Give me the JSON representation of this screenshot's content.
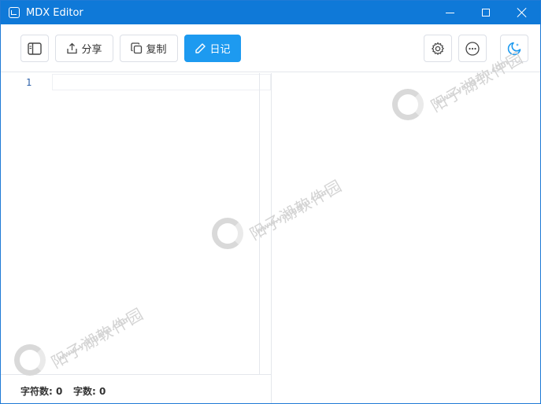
{
  "window": {
    "title": "MDX Editor",
    "controls": {
      "minimize": "minimize",
      "maximize": "maximize",
      "close": "close"
    }
  },
  "toolbar": {
    "sidebar_toggle_icon": "sidebar-icon",
    "share_label": "分享",
    "copy_label": "复制",
    "diary_label": "日记",
    "settings_icon": "gear-icon",
    "more_icon": "more-icon",
    "theme_icon": "moon-icon"
  },
  "editor": {
    "line_numbers": [
      "1"
    ],
    "content": ""
  },
  "statusbar": {
    "char_count_label": "字符数: 0",
    "word_count_label": "字数: 0"
  },
  "watermark": {
    "text": "阳子湖软件园",
    "url": "www.yangzhu.com"
  },
  "colors": {
    "titlebar": "#0f79d8",
    "primary_button": "#1d9af0",
    "line_number": "#2b5fa8"
  }
}
